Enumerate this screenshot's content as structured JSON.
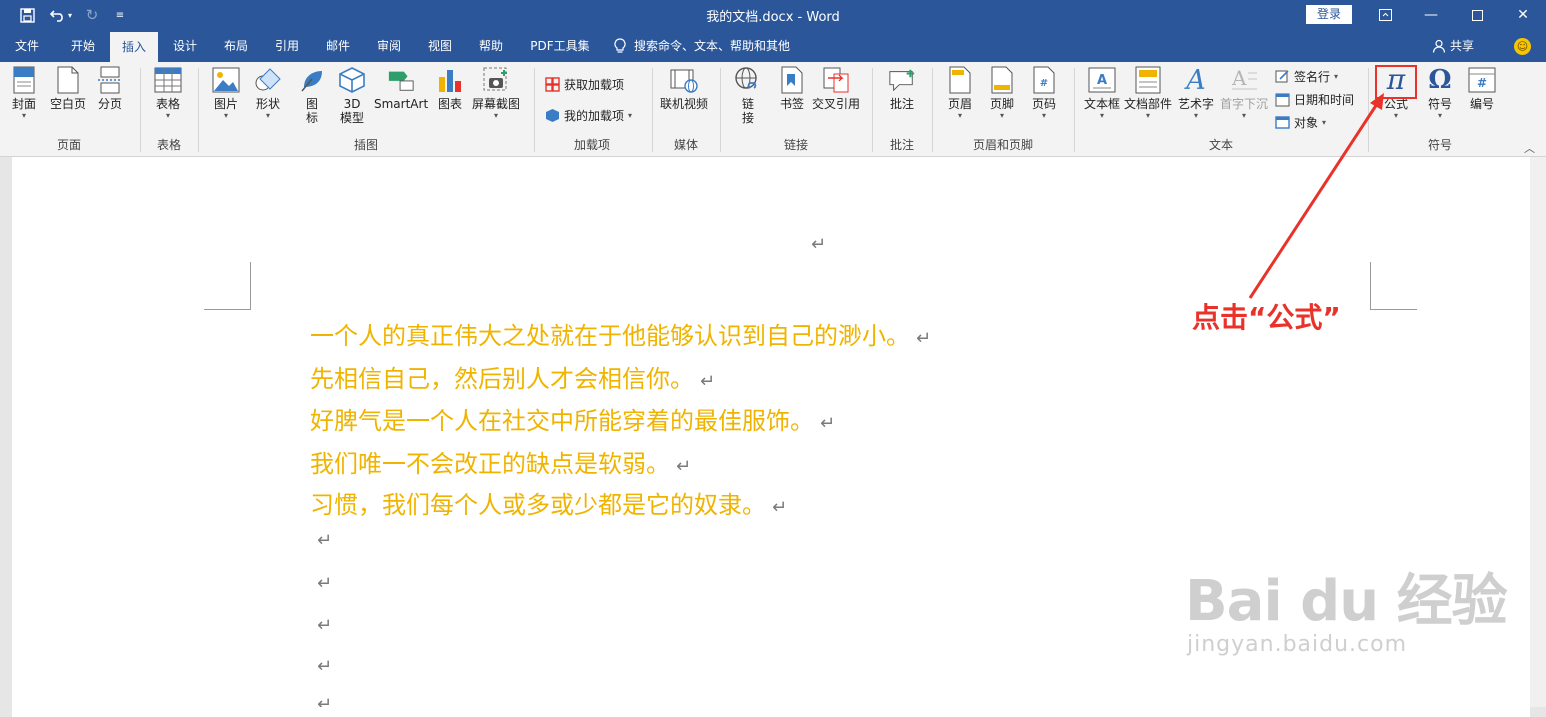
{
  "titlebar": {
    "doc_title": "我的文档.docx  -  Word",
    "login_label": "登录"
  },
  "tabs": [
    "文件",
    "开始",
    "插入",
    "设计",
    "布局",
    "引用",
    "邮件",
    "审阅",
    "视图",
    "帮助",
    "PDF工具集"
  ],
  "active_tab": "插入",
  "search_label": "搜索命令、文本、帮助和其他",
  "share_label": "共享",
  "ribbon": {
    "page_group": {
      "label": "页面",
      "cover": "封面",
      "blank": "空白页",
      "break": "分页"
    },
    "table_group": {
      "label": "表格",
      "table": "表格"
    },
    "illust_group": {
      "label": "插图",
      "picture": "图片",
      "shape": "形状",
      "icon1": "图",
      "icon2": "标",
      "model1": "3D",
      "model2": "模型",
      "smartart": "SmartArt",
      "chart": "图表",
      "screenshot": "屏幕截图"
    },
    "addin_group": {
      "label": "加载项",
      "get": "获取加载项",
      "mine": "我的加载项"
    },
    "media_group": {
      "label": "媒体",
      "video": "联机视频"
    },
    "link_group": {
      "label": "链接",
      "link1": "链",
      "link2": "接",
      "bookmark": "书签",
      "xref": "交叉引用"
    },
    "comment_group": {
      "label": "批注",
      "comment": "批注"
    },
    "hf_group": {
      "label": "页眉和页脚",
      "header": "页眉",
      "footer": "页脚",
      "pagenum": "页码"
    },
    "text_group": {
      "label": "文本",
      "textbox": "文本框",
      "parts": "文档部件",
      "wordart": "艺术字",
      "dropcap": "首字下沉",
      "signature": "签名行",
      "datetime": "日期和时间",
      "object": "对象"
    },
    "symbol_group": {
      "label": "符号",
      "equation": "公式",
      "symbol": "符号",
      "number": "编号"
    }
  },
  "document": {
    "lines": [
      "一个人的真正伟大之处就在于他能够认识到自己的渺小。",
      "先相信自己，然后别人才会相信你。",
      "好脾气是一个人在社交中所能穿着的最佳服饰。",
      "我们唯一不会改正的缺点是软弱。",
      "习惯，我们每个人或多或少都是它的奴隶。"
    ],
    "paragraph_mark": "↵"
  },
  "annotation_text": "点击“公式”",
  "watermark": {
    "brand": "Bai du 经验",
    "url": "jingyan.baidu.com"
  },
  "colors": {
    "brand": "#2b579a",
    "doc_text": "#f0b400",
    "annotation": "#e8322a"
  }
}
